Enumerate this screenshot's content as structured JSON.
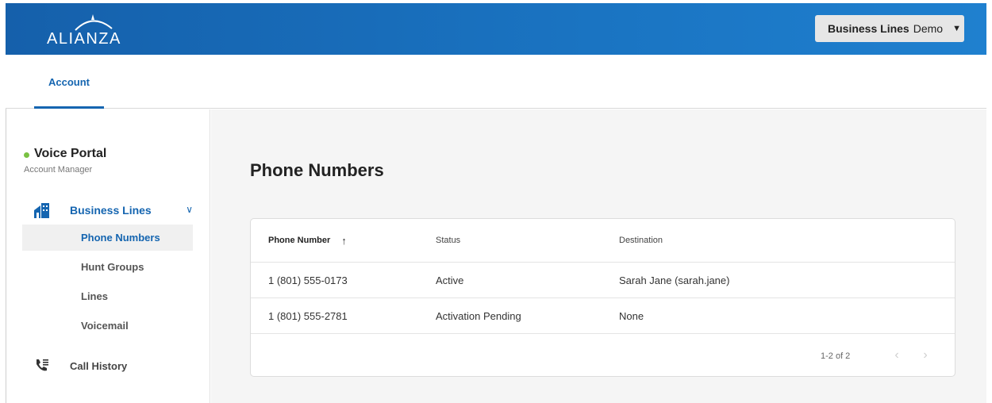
{
  "header": {
    "logo_text": "ALIANZA",
    "account_bold": "Business Lines",
    "account_rest": "Demo",
    "caret_icon": "caret-down-icon",
    "brand_color": "#1a74c2"
  },
  "tabs": [
    {
      "label": "Account",
      "active": true
    }
  ],
  "sidebar": {
    "portal_title": "Voice Portal",
    "portal_subtitle": "Account Manager",
    "status_color": "#7ac143",
    "group": {
      "label": "Business Lines",
      "icon": "building-icon",
      "expanded": true,
      "items": [
        {
          "label": "Phone Numbers",
          "active": true
        },
        {
          "label": "Hunt Groups",
          "active": false
        },
        {
          "label": "Lines",
          "active": false
        },
        {
          "label": "Voicemail",
          "active": false
        }
      ]
    },
    "call_history": {
      "label": "Call History",
      "icon": "phone-list-icon"
    }
  },
  "main": {
    "title": "Phone Numbers",
    "table": {
      "columns": [
        "Phone Number",
        "Status",
        "Destination"
      ],
      "sorted_column": "Phone Number",
      "sort_direction": "ascending",
      "rows": [
        {
          "phone": "1 (801) 555-0173",
          "status": "Active",
          "destination": "Sarah Jane (sarah.jane)"
        },
        {
          "phone": "1 (801) 555-2781",
          "status": "Activation Pending",
          "destination": "None"
        }
      ]
    },
    "pagination": {
      "text": "1-2 of 2",
      "prev_icon": "chevron-left-icon",
      "next_icon": "chevron-right-icon"
    }
  }
}
